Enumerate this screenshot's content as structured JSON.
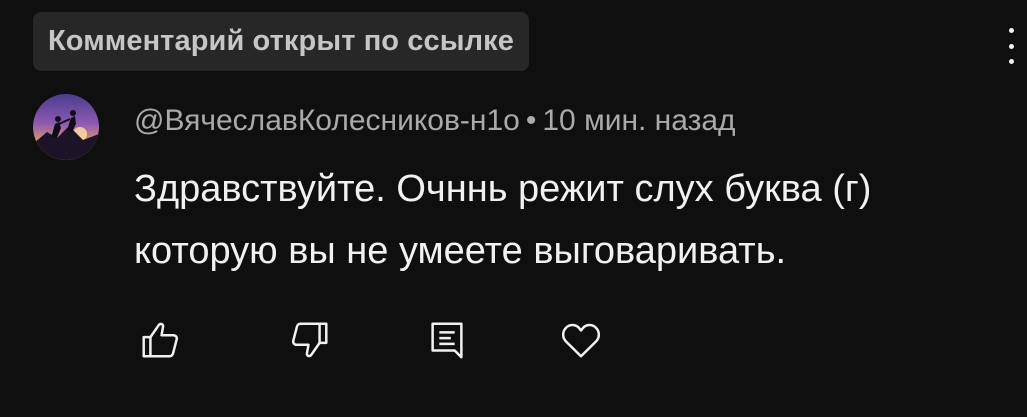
{
  "banner": {
    "label": "Комментарий открыт по ссылке"
  },
  "comment": {
    "author": "@ВячеславКолесников-н1о",
    "separator": "•",
    "time": "10 мин. назад",
    "text": "Здравствуйте. Очннь режит слух буква (г) которую вы не умеете выговаривать."
  },
  "icons": {
    "more": "vertical-dots-icon",
    "like": "thumbs-up-icon",
    "dislike": "thumbs-down-icon",
    "reply": "reply-comment-icon",
    "heart": "heart-icon"
  },
  "colors": {
    "background": "#0f0f0f",
    "badge": "#272727",
    "primary_text": "#f1f1f1",
    "secondary_text": "#aaaaaa"
  }
}
